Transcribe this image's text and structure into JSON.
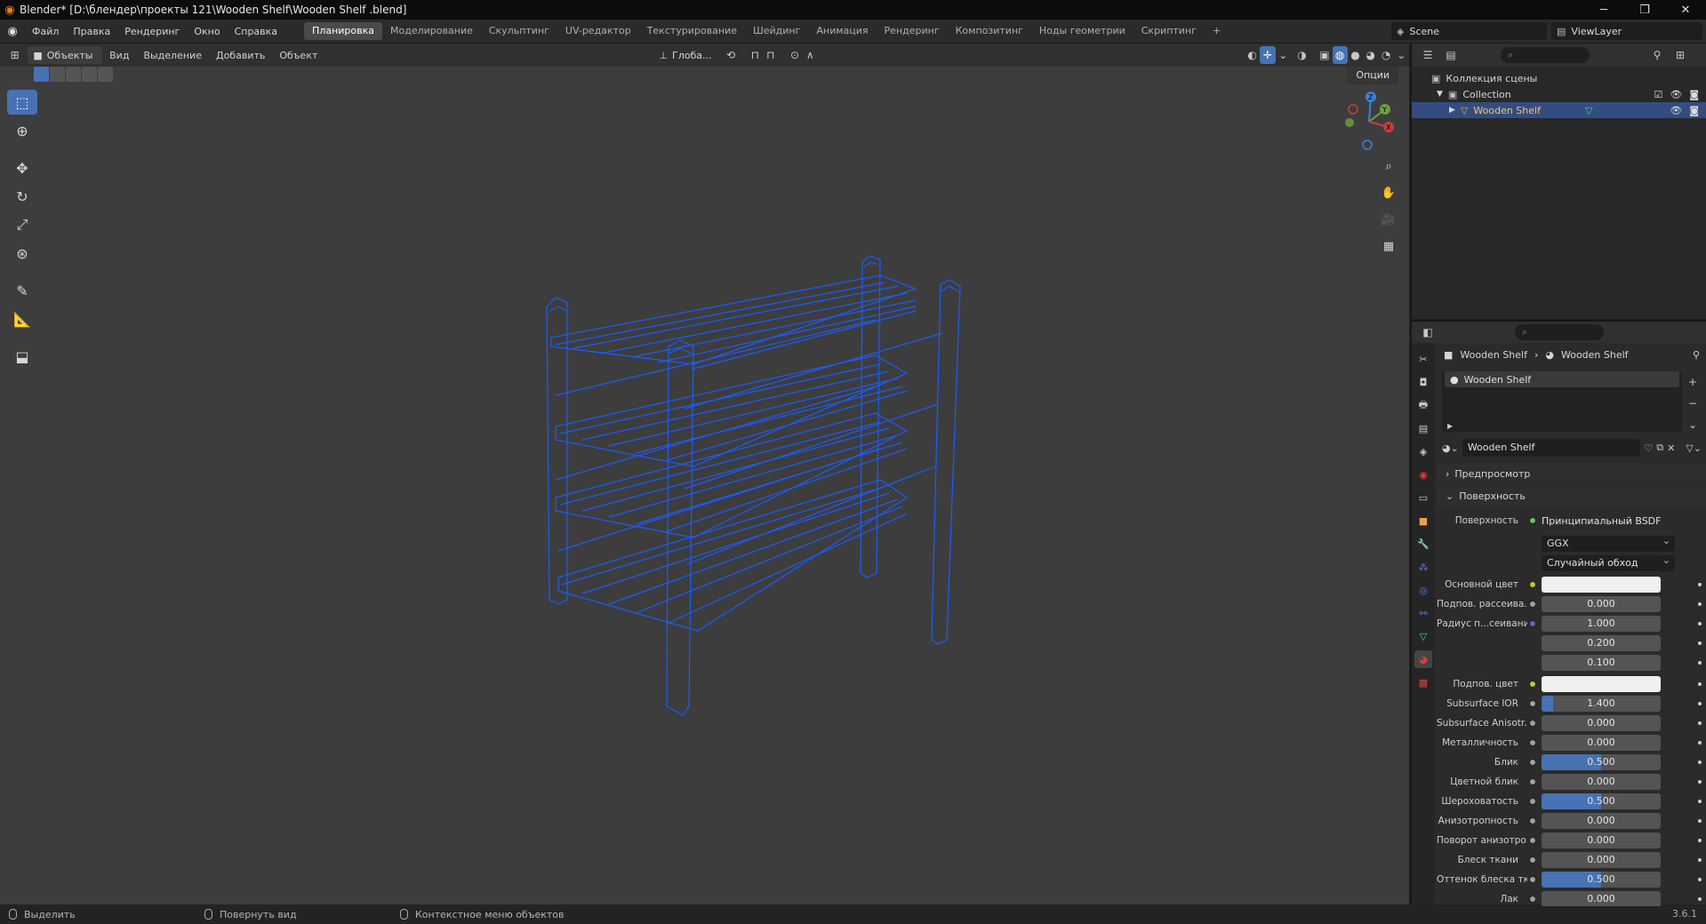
{
  "window": {
    "title": "Blender* [D:\\блендер\\проекты 121\\Wooden Shelf\\Wooden Shelf .blend]",
    "minimize": "─",
    "maximize": "❐",
    "close": "✕"
  },
  "menus": [
    "Файл",
    "Правка",
    "Рендеринг",
    "Окно",
    "Справка"
  ],
  "workspaces": [
    {
      "label": "Планировка",
      "active": true
    },
    {
      "label": "Моделирование",
      "active": false
    },
    {
      "label": "Скульптинг",
      "active": false
    },
    {
      "label": "UV-редактор",
      "active": false
    },
    {
      "label": "Текстурирование",
      "active": false
    },
    {
      "label": "Шейдинг",
      "active": false
    },
    {
      "label": "Анимация",
      "active": false
    },
    {
      "label": "Рендеринг",
      "active": false
    },
    {
      "label": "Композитинг",
      "active": false
    },
    {
      "label": "Ноды геометрии",
      "active": false
    },
    {
      "label": "Скриптинг",
      "active": false
    }
  ],
  "add_workspace": "+",
  "scene": {
    "name": "Scene"
  },
  "view_layer": {
    "name": "ViewLayer"
  },
  "viewport_header": {
    "mode": "Объекты",
    "menus": [
      "Вид",
      "Выделение",
      "Добавить",
      "Объект"
    ],
    "transform_orientation": "Глоба...",
    "options": "Опции"
  },
  "gizmo": {
    "x": "X",
    "y": "Y",
    "z": "Z"
  },
  "outliner": {
    "scene_collection": "Коллекция сцены",
    "collection": "Collection",
    "object": "Wooden Shelf"
  },
  "properties": {
    "breadcrumb_object": "Wooden Shelf",
    "breadcrumb_material": "Wooden Shelf",
    "slot_name": "Wooden Shelf",
    "material_name": "Wooden Shelf",
    "panel_preview": "Предпросмотр",
    "panel_surface": "Поверхность",
    "surface_label": "Поверхность",
    "surface_shader": "Принципиальный BSDF",
    "distribution": "GGX",
    "subsurface_method": "Случайный обход",
    "rows": [
      {
        "label": "Основной цвет",
        "type": "color",
        "socket": "yellow",
        "value": "#f0f0f0"
      },
      {
        "label": "Подпов. рассеива...",
        "type": "value",
        "socket": "gray",
        "value": "0.000",
        "fill": 0
      },
      {
        "label": "Радиус п...сеивания",
        "type": "value",
        "socket": "purple",
        "value": "1.000",
        "fill": 0
      },
      {
        "label": "",
        "type": "value",
        "socket": "",
        "value": "0.200",
        "fill": 0
      },
      {
        "label": "",
        "type": "value",
        "socket": "",
        "value": "0.100",
        "fill": 0
      },
      {
        "label": "Подпов. цвет",
        "type": "color",
        "socket": "yellow",
        "value": "#f0f0f0"
      },
      {
        "label": "Subsurface IOR",
        "type": "value",
        "socket": "gray",
        "value": "1.400",
        "fill": 0.1
      },
      {
        "label": "Subsurface Anisotr...",
        "type": "value",
        "socket": "gray",
        "value": "0.000",
        "fill": 0
      },
      {
        "label": "Металличность",
        "type": "value",
        "socket": "gray",
        "value": "0.000",
        "fill": 0
      },
      {
        "label": "Блик",
        "type": "value",
        "socket": "gray",
        "value": "0.500",
        "fill": 0.5
      },
      {
        "label": "Цветной блик",
        "type": "value",
        "socket": "gray",
        "value": "0.000",
        "fill": 0
      },
      {
        "label": "Шероховатость",
        "type": "value",
        "socket": "gray",
        "value": "0.500",
        "fill": 0.5
      },
      {
        "label": "Анизотропность",
        "type": "value",
        "socket": "gray",
        "value": "0.000",
        "fill": 0
      },
      {
        "label": "Поворот анизотро...",
        "type": "value",
        "socket": "gray",
        "value": "0.000",
        "fill": 0
      },
      {
        "label": "Блеск ткани",
        "type": "value",
        "socket": "gray",
        "value": "0.000",
        "fill": 0
      },
      {
        "label": "Оттенок блеска тк...",
        "type": "value",
        "socket": "gray",
        "value": "0.500",
        "fill": 0.5
      },
      {
        "label": "Лак",
        "type": "value",
        "socket": "gray",
        "value": "0.000",
        "fill": 0
      }
    ]
  },
  "status": {
    "left": "Выделить",
    "middle": "Повернуть вид",
    "right": "Контекстное меню объектов",
    "version": "3.6.1"
  },
  "colors": {
    "accent": "#4772b3",
    "wire": "#1a5cff",
    "selected_row": "#334d80"
  }
}
